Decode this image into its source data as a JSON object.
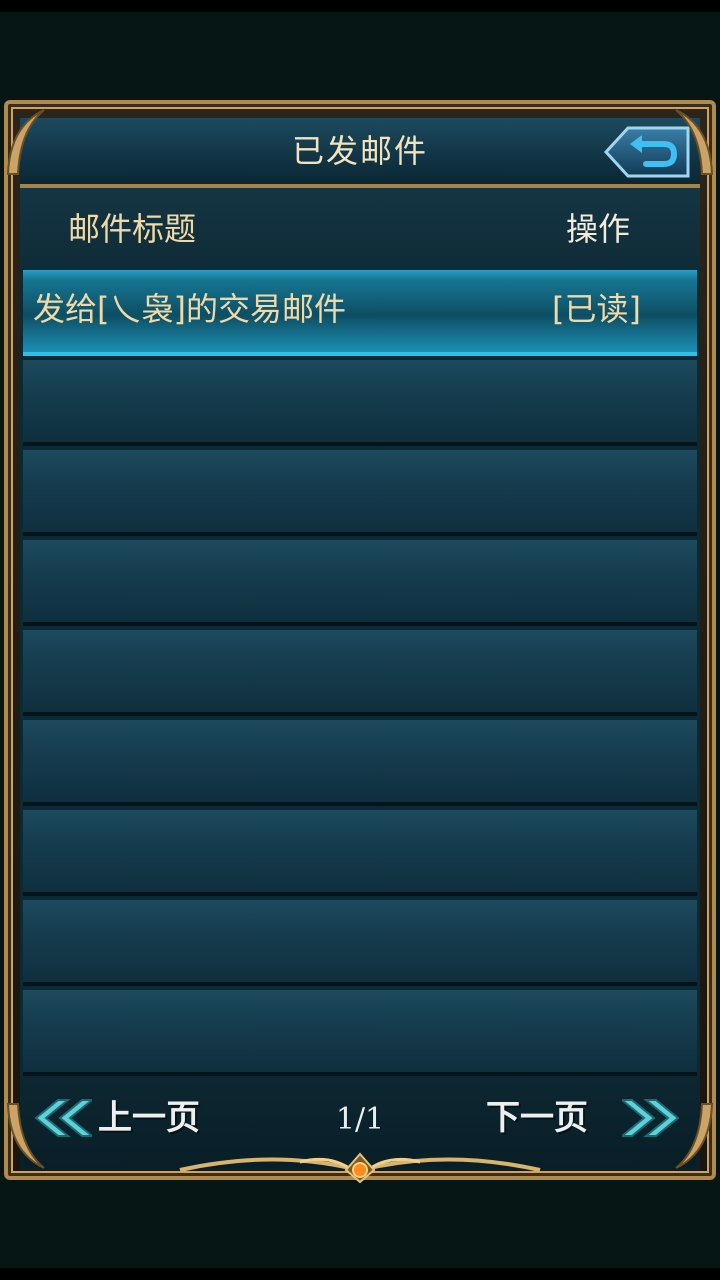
{
  "header": {
    "title": "已发邮件",
    "back_icon": "return-arrow-icon"
  },
  "columns": {
    "title": "邮件标题",
    "operation": "操作"
  },
  "mails": [
    {
      "title": "发给[乀袅]的交易邮件",
      "action": "[已读]",
      "selected": true
    },
    {
      "title": "",
      "action": ""
    },
    {
      "title": "",
      "action": ""
    },
    {
      "title": "",
      "action": ""
    },
    {
      "title": "",
      "action": ""
    },
    {
      "title": "",
      "action": ""
    },
    {
      "title": "",
      "action": ""
    },
    {
      "title": "",
      "action": ""
    },
    {
      "title": "",
      "action": ""
    }
  ],
  "pagination": {
    "prev_label": "上一页",
    "next_label": "下一页",
    "page": "1/1",
    "prev_icon": "double-chevron-left-icon",
    "next_icon": "double-chevron-right-icon"
  },
  "colors": {
    "panel": "#0c2a35",
    "gold_text": "#f0d9a8",
    "frame_gold": "#b08a4e",
    "selected_row": "#1a8fb4"
  }
}
